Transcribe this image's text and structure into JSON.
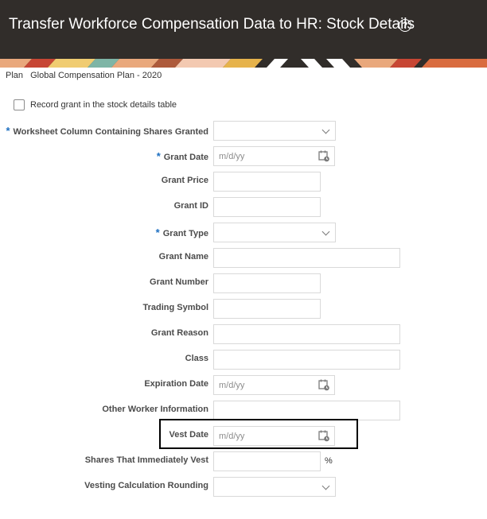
{
  "header": {
    "title": "Transfer Workforce Compensation Data to HR: Stock Details",
    "help_icon": "question-circle-icon",
    "background": "#312d2a"
  },
  "plan": {
    "label": "Plan",
    "value": "Global Compensation Plan - 2020"
  },
  "record_grant": {
    "label": "Record grant in the stock details table",
    "checked": false
  },
  "fields": {
    "worksheet_column": {
      "label": "Worksheet Column Containing Shares Granted",
      "required": true,
      "value": ""
    },
    "grant_date": {
      "label": "Grant Date",
      "required": true,
      "placeholder": "m/d/yy"
    },
    "grant_price": {
      "label": "Grant Price",
      "value": ""
    },
    "grant_id": {
      "label": "Grant ID",
      "value": ""
    },
    "grant_type": {
      "label": "Grant Type",
      "required": true,
      "value": ""
    },
    "grant_name": {
      "label": "Grant Name",
      "value": ""
    },
    "grant_number": {
      "label": "Grant Number",
      "value": ""
    },
    "trading_symbol": {
      "label": "Trading Symbol",
      "value": ""
    },
    "grant_reason": {
      "label": "Grant Reason",
      "value": ""
    },
    "class": {
      "label": "Class",
      "value": ""
    },
    "expiration_date": {
      "label": "Expiration Date",
      "placeholder": "m/d/yy"
    },
    "other_worker_info": {
      "label": "Other Worker Information",
      "value": ""
    },
    "vest_date": {
      "label": "Vest Date",
      "placeholder": "m/d/yy"
    },
    "shares_immediately_vest": {
      "label": "Shares That Immediately Vest",
      "value": "",
      "suffix": "%"
    },
    "vesting_rounding": {
      "label": "Vesting Calculation Rounding",
      "value": ""
    }
  },
  "colors": {
    "required_marker": "#1d6fc1",
    "highlight_border": "#000000"
  }
}
